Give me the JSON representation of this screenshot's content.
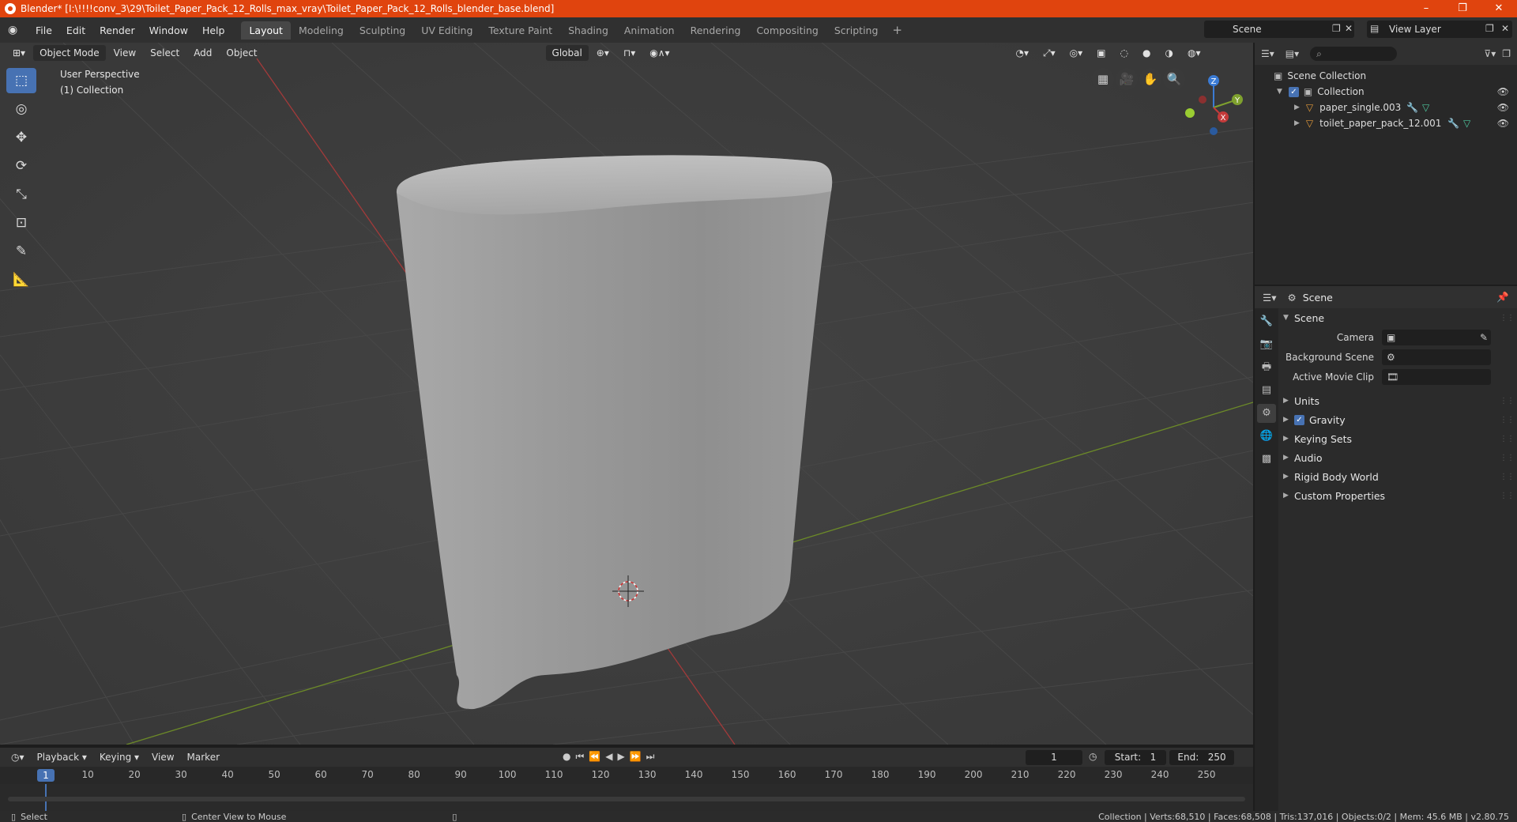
{
  "window": {
    "title": "Blender* [I:\\!!!!conv_3\\29\\Toilet_Paper_Pack_12_Rolls_max_vray\\Toilet_Paper_Pack_12_Rolls_blender_base.blend]",
    "min": "–",
    "max": "❐",
    "close": "✕"
  },
  "menu": {
    "items": [
      "File",
      "Edit",
      "Render",
      "Window",
      "Help"
    ]
  },
  "workspaces": [
    "Layout",
    "Modeling",
    "Sculpting",
    "UV Editing",
    "Texture Paint",
    "Shading",
    "Animation",
    "Rendering",
    "Compositing",
    "Scripting"
  ],
  "workspace_add": "+",
  "scene": {
    "name": "Scene",
    "view_layer": "View Layer"
  },
  "viewport": {
    "mode": "Object Mode",
    "menus": [
      "View",
      "Select",
      "Add",
      "Object"
    ],
    "orientation": "Global",
    "info_line1": "User Perspective",
    "info_line2": "(1) Collection",
    "gizmo_labels": {
      "z": "Z",
      "y": "Y",
      "x": "X"
    }
  },
  "outliner": {
    "root": "Scene Collection",
    "collection": "Collection",
    "objects": [
      "paper_single.003",
      "toilet_paper_pack_12.001"
    ]
  },
  "properties": {
    "header": "Scene",
    "section": "Scene",
    "fields": [
      {
        "label": "Camera",
        "value": ""
      },
      {
        "label": "Background Scene",
        "value": ""
      },
      {
        "label": "Active Movie Clip",
        "value": ""
      }
    ],
    "subsections": [
      "Units",
      "Gravity",
      "Keying Sets",
      "Audio",
      "Rigid Body World",
      "Custom Properties"
    ]
  },
  "timeline": {
    "menus": [
      "Playback",
      "Keying",
      "View",
      "Marker"
    ],
    "current_frame": "1",
    "start_label": "Start:",
    "start": "1",
    "end_label": "End:",
    "end": "250",
    "ruler": [
      "1",
      "10",
      "20",
      "30",
      "40",
      "50",
      "60",
      "70",
      "80",
      "90",
      "100",
      "110",
      "120",
      "130",
      "140",
      "150",
      "160",
      "170",
      "180",
      "190",
      "200",
      "210",
      "220",
      "230",
      "240",
      "250"
    ]
  },
  "status": {
    "left1": "Select",
    "left2": "Center View to Mouse",
    "right": "Collection | Verts:68,510 | Faces:68,508 | Tris:137,016 | Objects:0/2 | Mem: 45.6 MB | v2.80.75"
  },
  "colors": {
    "accent": "#4772b3",
    "titlebar": "#e0440e",
    "xaxis": "#c33a3a",
    "yaxis": "#7fa12e"
  }
}
